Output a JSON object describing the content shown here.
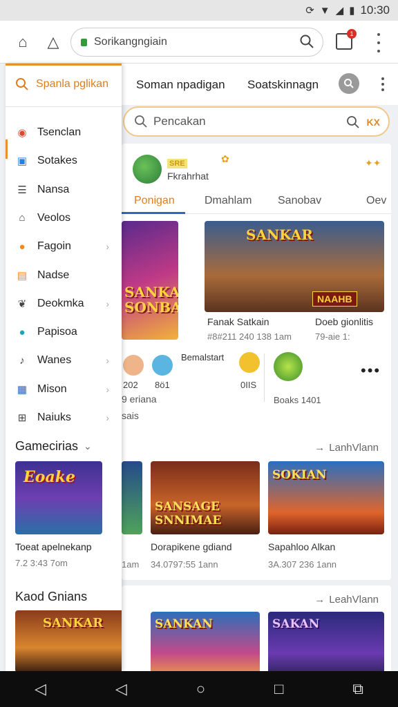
{
  "status": {
    "time": "10:30"
  },
  "browser": {
    "url": "Sorikangngiain",
    "tabs_count": "1"
  },
  "topnav": {
    "item1": "Soman npadigan",
    "item2": "Soatskinnagn"
  },
  "search": {
    "placeholder": "Pencakan",
    "right_label": "KX"
  },
  "profile": {
    "badge": "SRE",
    "name": "Fkrahrhat"
  },
  "subtabs": [
    "Ponigan",
    "Dmahlam",
    "Sanobav",
    "Oev"
  ],
  "featured": {
    "banner1_title": "SANKAR SONBAVI",
    "banner2_title": "SANKAR",
    "banner2_tag": "NAAHB",
    "games": [
      {
        "title": "Fanak Satkain",
        "meta": "#8#211 240 138 1am"
      },
      {
        "title": "Doeb gionlitis",
        "meta": "79-aie 1:"
      }
    ]
  },
  "people": {
    "label": "Bemalstart",
    "nums": [
      "202",
      "8ö1",
      "0IIS"
    ],
    "caption1": "9 eriana",
    "caption2": "sais",
    "caption3": "Boaks 1401"
  },
  "lane1": {
    "link": "LanhVlann",
    "games": [
      {
        "title": "Dorapikene gdiand",
        "meta": "34.0797:55 1ann",
        "art": "SANSAGE SNNIMAE"
      },
      {
        "title": "Sapahloo Alkan",
        "meta": "3A.307 236 1ann",
        "art": "SOKIAN"
      }
    ],
    "partial_meta": "1am"
  },
  "lane2": {
    "link": "LeahVlann"
  },
  "drawer": {
    "search_label": "Spanla pglikan",
    "items": [
      {
        "label": "Tsenclan",
        "icon": "target-icon",
        "color": "#e0482e",
        "chev": false
      },
      {
        "label": "Sotakes",
        "icon": "image-icon",
        "color": "#2f7fd4",
        "chev": false
      },
      {
        "label": "Nansa",
        "icon": "document-icon",
        "color": "#444444",
        "chev": false
      },
      {
        "label": "Veolos",
        "icon": "home-icon",
        "color": "#444444",
        "chev": false
      },
      {
        "label": "Fagoin",
        "icon": "orange-circle-icon",
        "color": "#f08a1c",
        "chev": true
      },
      {
        "label": "Nadse",
        "icon": "book-icon",
        "color": "#f08a1c",
        "chev": false
      },
      {
        "label": "Deokmka",
        "icon": "leaf-icon",
        "color": "#444444",
        "chev": true
      },
      {
        "label": "Papisoa",
        "icon": "teal-badge-icon",
        "color": "#1ba3b8",
        "chev": false
      },
      {
        "label": "Wanes",
        "icon": "music-icon",
        "color": "#444444",
        "chev": true
      },
      {
        "label": "Mison",
        "icon": "calendar-icon",
        "color": "#2f5fb4",
        "chev": true
      },
      {
        "label": "Naiuks",
        "icon": "grid-icon",
        "color": "#444444",
        "chev": true
      }
    ],
    "games_heading": "Gamecirias",
    "games_art": "Eoake",
    "game_title": "Toeat apelnekanp",
    "game_meta": "7.2 3:43 7om",
    "heading2": "Kaod Gnians",
    "thumb2_art": "SANKAR"
  },
  "lane2_arts": [
    "SANKAN",
    "SAKAN"
  ]
}
